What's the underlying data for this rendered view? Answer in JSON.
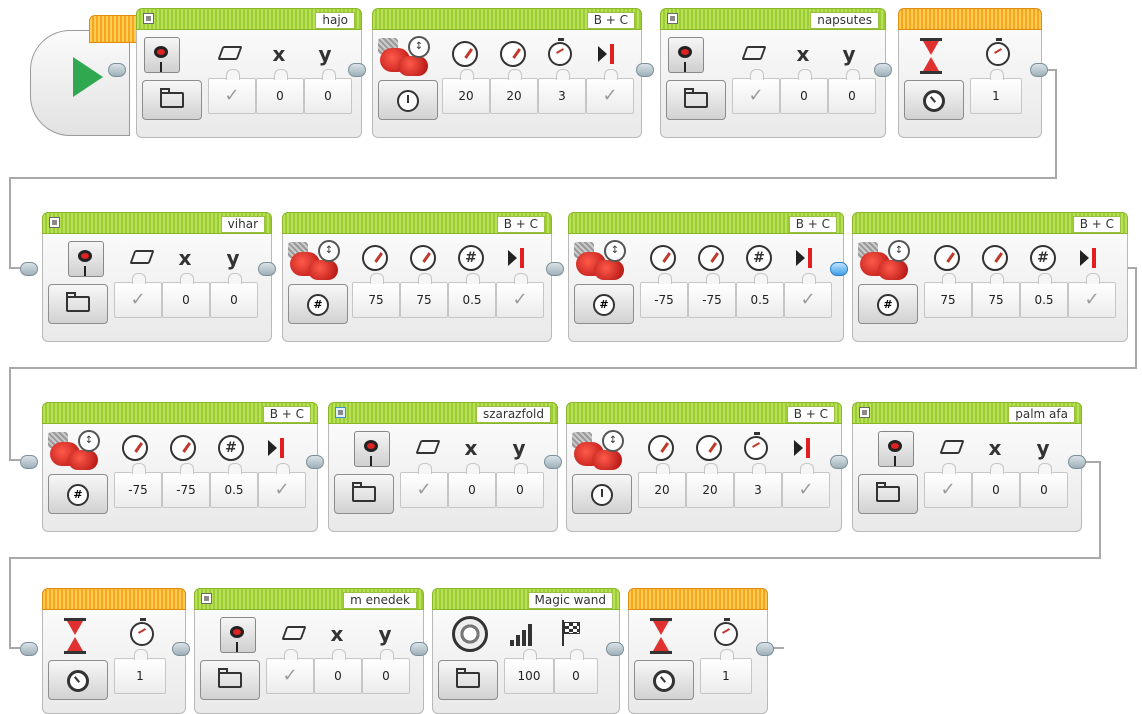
{
  "program": {
    "start_label": "",
    "blocks": {
      "disp_hajo": {
        "label": "hajo",
        "x": "0",
        "y": "0"
      },
      "motor1": {
        "ports": "B + C",
        "p1": "20",
        "p2": "20",
        "p3": "3"
      },
      "disp_napsutes": {
        "label": "napsutes",
        "x": "0",
        "y": "0"
      },
      "wait1": {
        "value": "1"
      },
      "disp_vihar": {
        "label": "vihar",
        "x": "0",
        "y": "0"
      },
      "motor2": {
        "ports": "B + C",
        "p1": "75",
        "p2": "75",
        "p3": "0.5"
      },
      "motor3": {
        "ports": "B + C",
        "p1": "-75",
        "p2": "-75",
        "p3": "0.5"
      },
      "motor4": {
        "ports": "B + C",
        "p1": "75",
        "p2": "75",
        "p3": "0.5"
      },
      "motor5": {
        "ports": "B + C",
        "p1": "-75",
        "p2": "-75",
        "p3": "0.5"
      },
      "disp_szarazfold": {
        "label": "szarazfold",
        "x": "0",
        "y": "0"
      },
      "motor6": {
        "ports": "B + C",
        "p1": "20",
        "p2": "20",
        "p3": "3"
      },
      "disp_palmafa": {
        "label": "palm afa",
        "x": "0",
        "y": "0"
      },
      "wait2": {
        "value": "1"
      },
      "disp_menedek": {
        "label": "m enedek",
        "x": "0",
        "y": "0"
      },
      "sound": {
        "label": "Magic wand",
        "volume": "100",
        "play_type": "0"
      },
      "wait3": {
        "value": "1"
      }
    },
    "icons": {
      "x_letter": "x",
      "y_letter": "y",
      "hash": "#",
      "motor_adj": "↕"
    }
  },
  "colors": {
    "block_green": "#9ccd32",
    "wait_orange": "#f7a51c",
    "play_green": "#2fa84f",
    "wire": "#a9a9a9",
    "active_plug": "#3fa0e6"
  }
}
